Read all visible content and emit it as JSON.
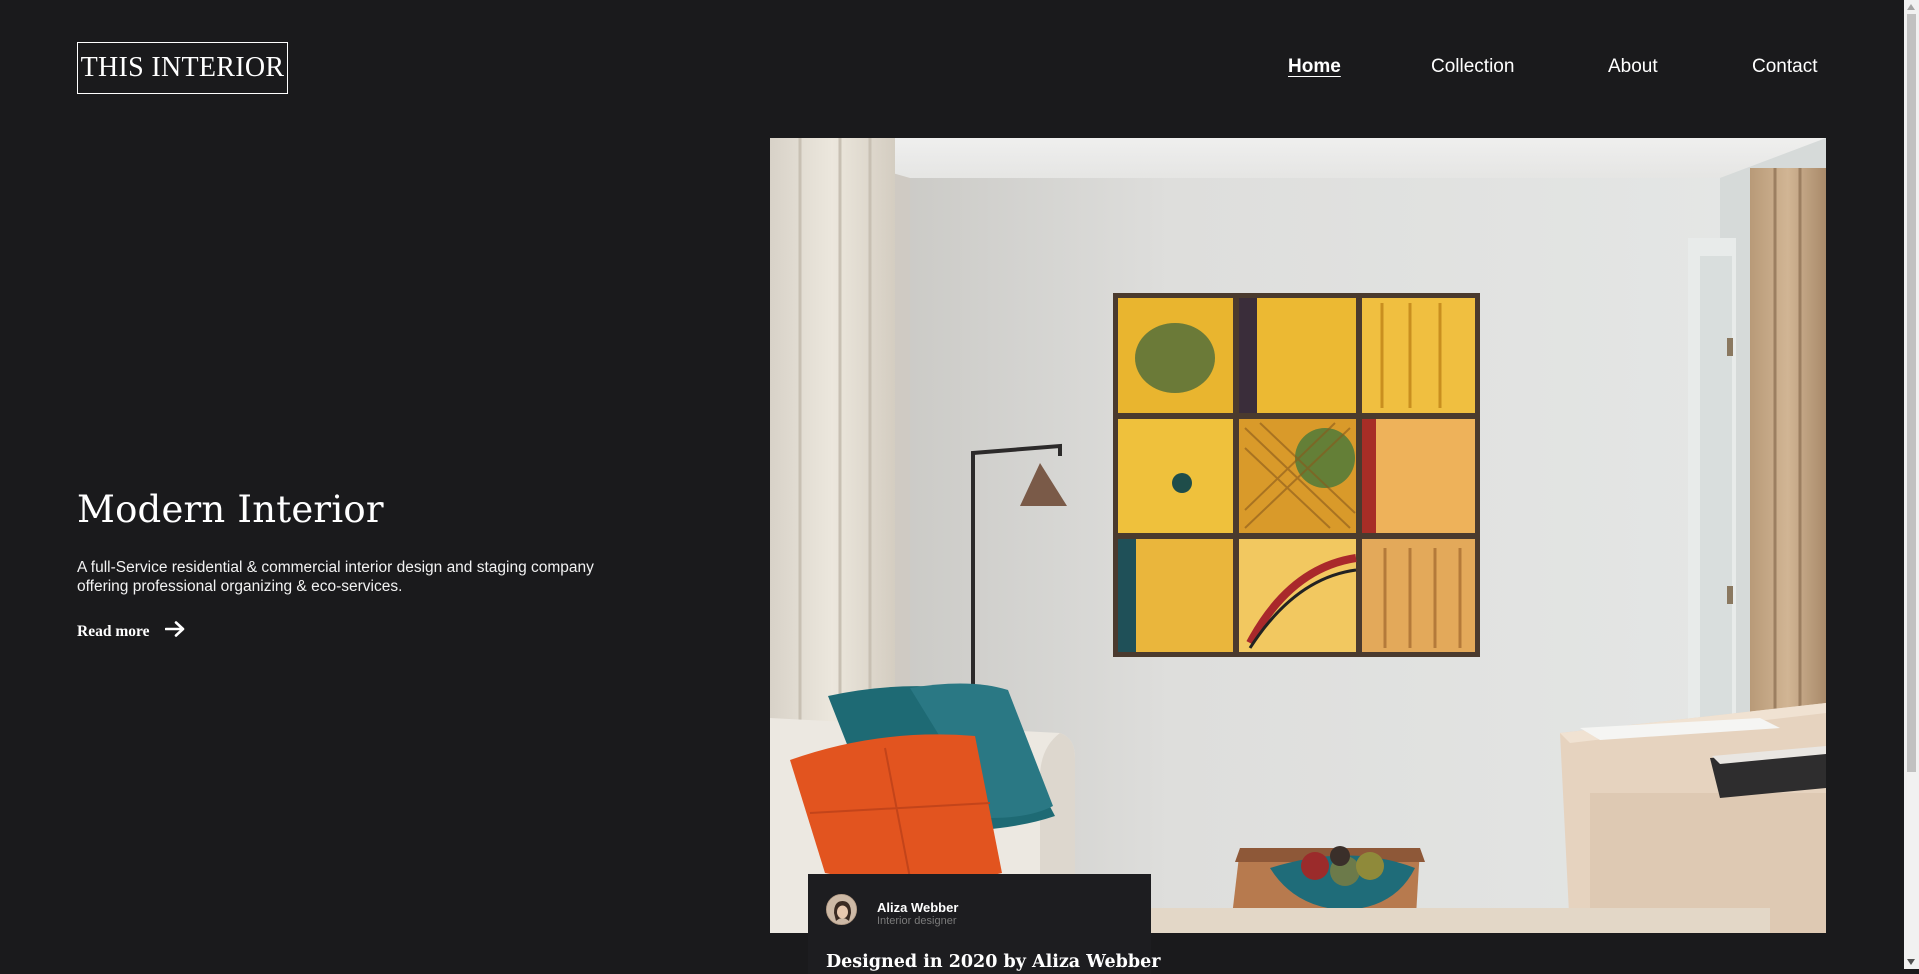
{
  "brand": {
    "logo_text": "THIS INTERIOR"
  },
  "nav": {
    "items": [
      {
        "label": "Home",
        "active": true
      },
      {
        "label": "Collection",
        "active": false
      },
      {
        "label": "About",
        "active": false
      },
      {
        "label": "Contact",
        "active": false
      }
    ]
  },
  "hero": {
    "title": "Modern Interior",
    "description": "A full-Service residential & commercial interior design and staging company offering professional organizing & eco-services.",
    "read_more_label": "Read more",
    "read_more_icon": "arrow-right-icon"
  },
  "designer": {
    "name": "Aliza Webber",
    "role": "Interior designer",
    "caption": "Designed in 2020 by Aliza Webber"
  },
  "colors": {
    "background": "#1a1a1c",
    "text": "#ffffff",
    "card_background": "#1d1d20",
    "muted_text": "#7a7a7a"
  }
}
